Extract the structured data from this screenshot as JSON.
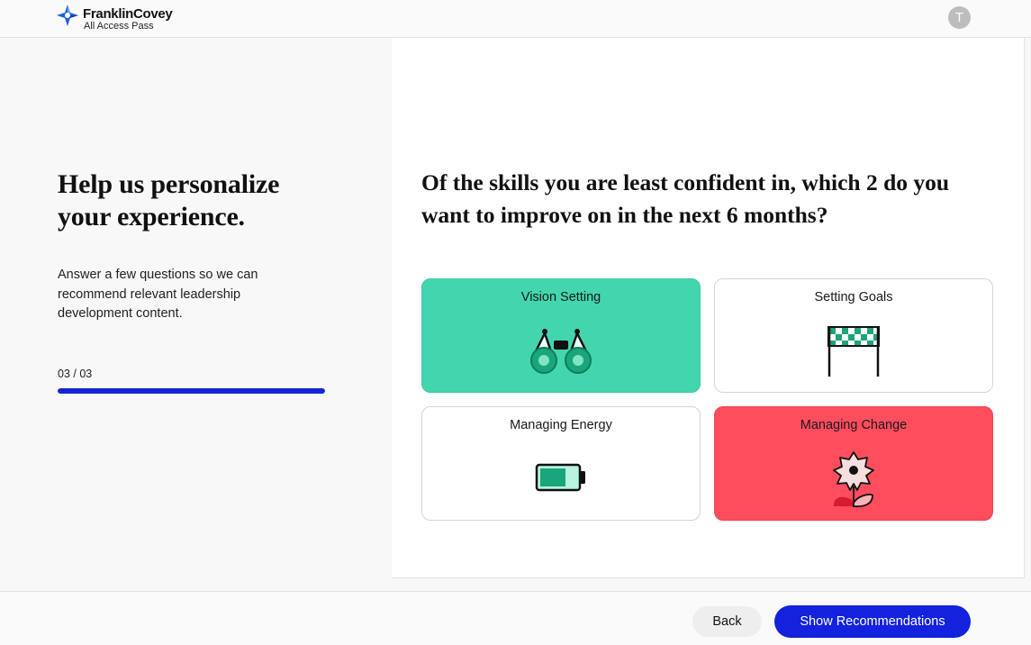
{
  "header": {
    "brand_name": "FranklinCovey",
    "brand_sub": "All Access Pass",
    "avatar_initial": "T"
  },
  "intro": {
    "title": "Help us personalize your experience.",
    "description": "Answer a few questions so we can recommend relevant leadership development content.",
    "step": "03 / 03",
    "progress": 1.0
  },
  "question": {
    "text": "Of the skills you are least confident in, which 2 do you want to improve on in the next 6 months?",
    "options": [
      {
        "label": "Vision Setting",
        "icon": "binoculars-icon",
        "selected": true,
        "color": "#43d6ae"
      },
      {
        "label": "Setting Goals",
        "icon": "finish-line-icon",
        "selected": false
      },
      {
        "label": "Managing Energy",
        "icon": "battery-icon",
        "selected": false
      },
      {
        "label": "Managing Change",
        "icon": "flower-icon",
        "selected": true,
        "color": "#ff4d5e"
      }
    ]
  },
  "footer": {
    "back_label": "Back",
    "submit_label": "Show Recommendations"
  },
  "colors": {
    "accent": "#1222dd",
    "progress": "#1525d6"
  }
}
